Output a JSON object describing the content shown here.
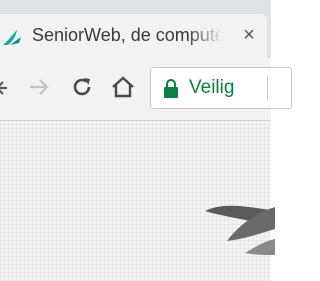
{
  "tab": {
    "title": "SeniorWeb, de computer",
    "close_glyph": "×",
    "favicon": "seniorweb-bird-icon"
  },
  "toolbar": {
    "back_icon": "arrow-left-icon",
    "forward_icon": "arrow-right-icon",
    "reload_icon": "reload-icon",
    "home_icon": "home-icon"
  },
  "omnibox": {
    "security_icon": "lock-icon",
    "security_label": "Veilig",
    "security_color": "#0b8043"
  },
  "content": {
    "logo": "seniorweb-bird-logo"
  }
}
